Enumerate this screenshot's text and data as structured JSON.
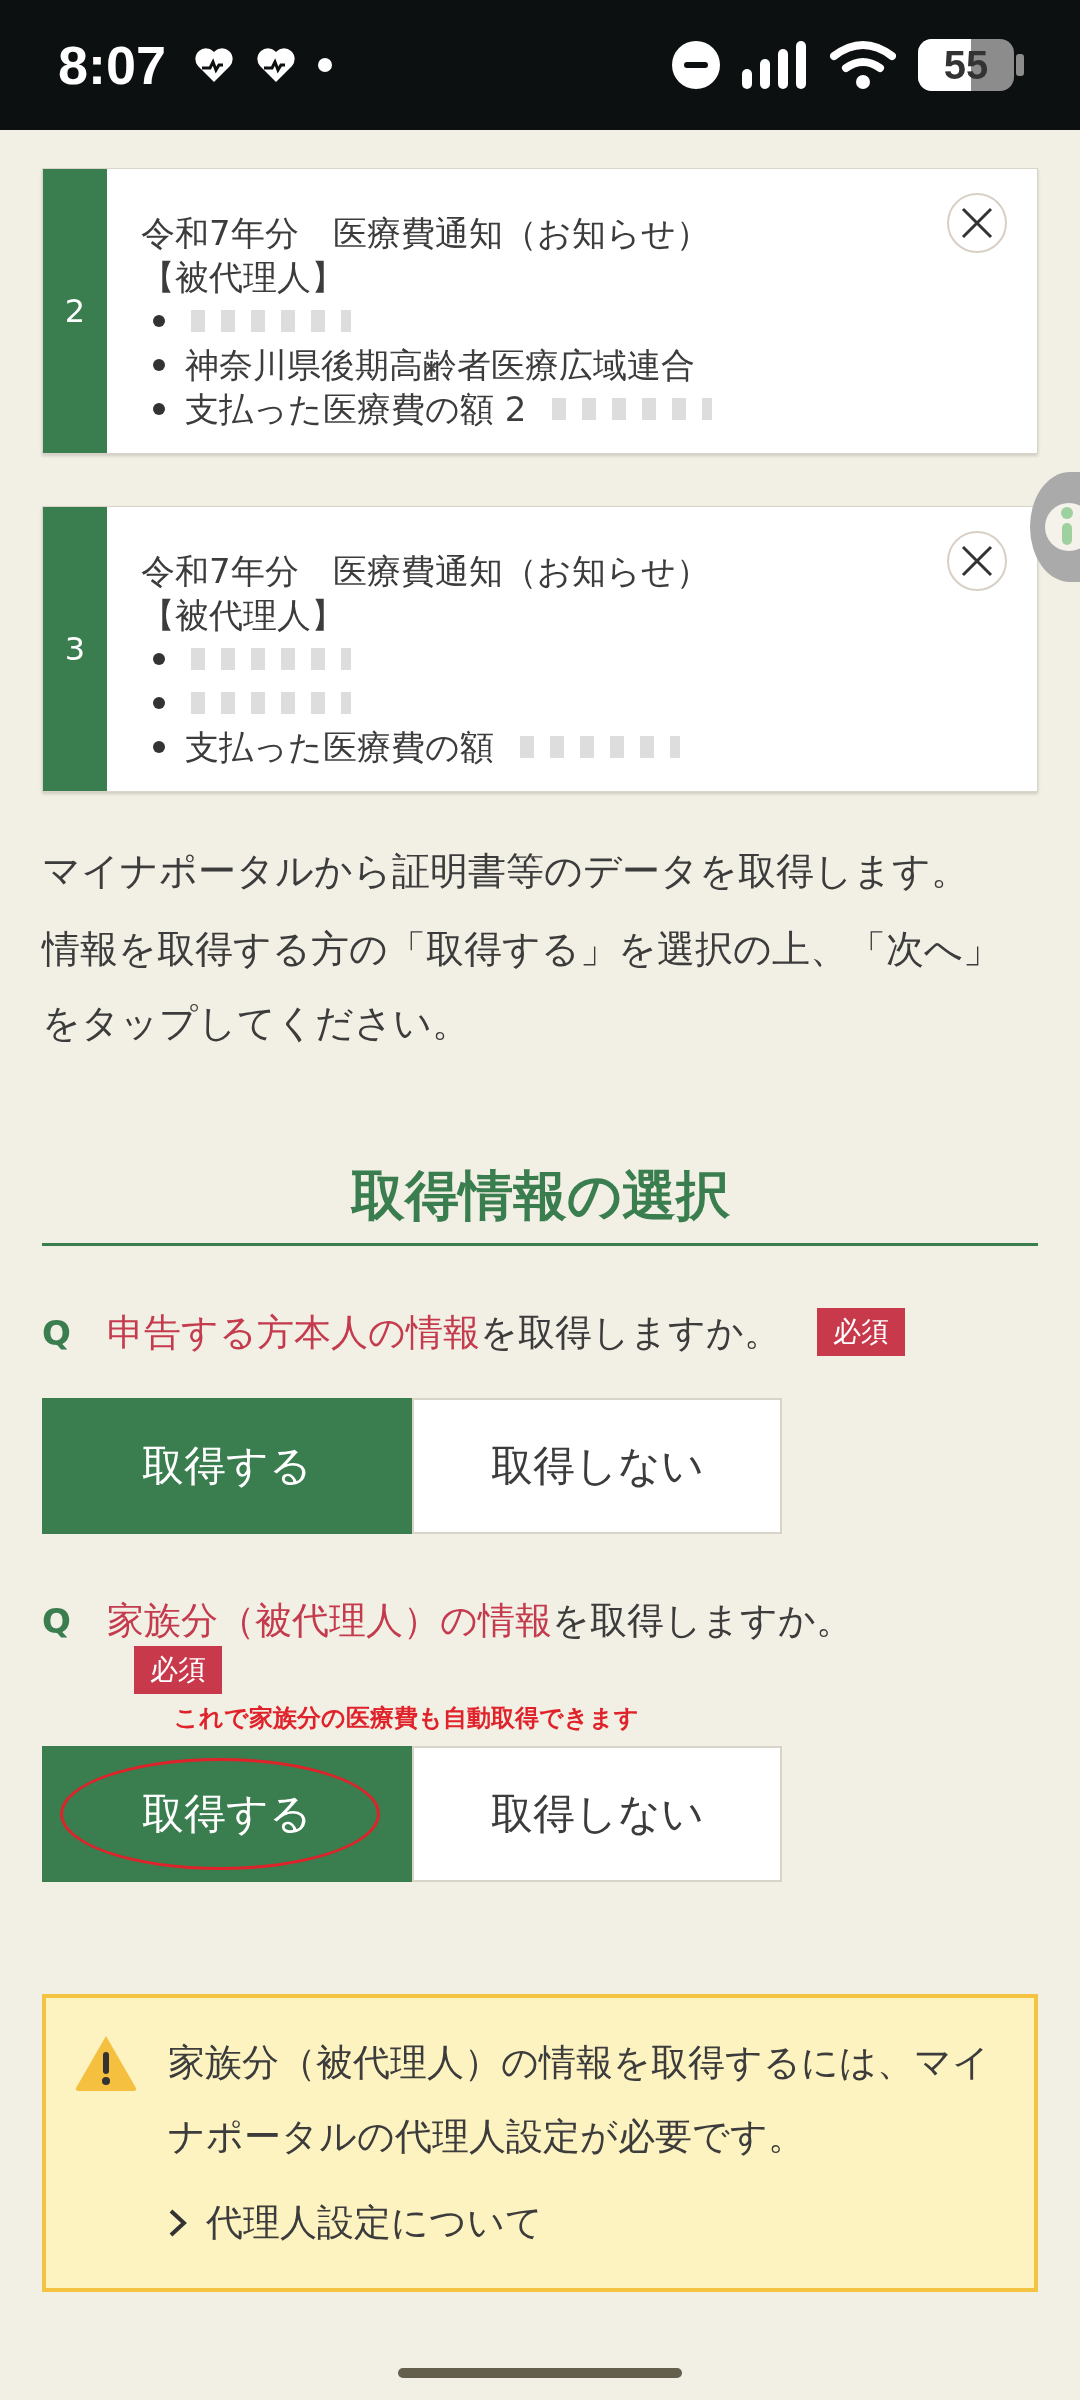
{
  "status_bar": {
    "time": "8:07",
    "battery": "55"
  },
  "notices": [
    {
      "number": "2",
      "title": "令和7年分　医療費通知（お知らせ）",
      "role": "【被代理人】",
      "items": [
        {
          "redacted": true
        },
        {
          "text": "神奈川県後期高齢者医療広域連合",
          "redacted": false
        },
        {
          "text": "支払った医療費の額 2",
          "redacted": true
        }
      ]
    },
    {
      "number": "3",
      "title": "令和7年分　医療費通知（お知らせ）",
      "role": "【被代理人】",
      "items": [
        {
          "redacted": true
        },
        {
          "redacted": true
        },
        {
          "text": "支払った医療費の額",
          "redacted": true
        }
      ]
    }
  ],
  "intro": [
    "マイナポータルから証明書等のデータを取得します。",
    "情報を取得する方の「取得する」を選択の上、「次へ」をタップしてください。"
  ],
  "section_title": "取得情報の選択",
  "questions": [
    {
      "q": "Q",
      "highlight": "申告する方本人の情報",
      "rest": "を取得しますか。",
      "required": "必須",
      "options": [
        {
          "label": "取得する",
          "selected": true,
          "circled": false
        },
        {
          "label": "取得しない",
          "selected": false,
          "circled": false
        }
      ]
    },
    {
      "q": "Q",
      "highlight": "家族分（被代理人）の情報",
      "rest": "を取得しますか。",
      "required": "必須",
      "note": "これで家族分の医療費も自動取得できます",
      "options": [
        {
          "label": "取得する",
          "selected": true,
          "circled": true
        },
        {
          "label": "取得しない",
          "selected": false,
          "circled": false
        }
      ]
    }
  ],
  "warning": {
    "text": "家族分（被代理人）の情報を取得するには、マイナポータルの代理人設定が必要です。",
    "link": "代理人設定について"
  }
}
